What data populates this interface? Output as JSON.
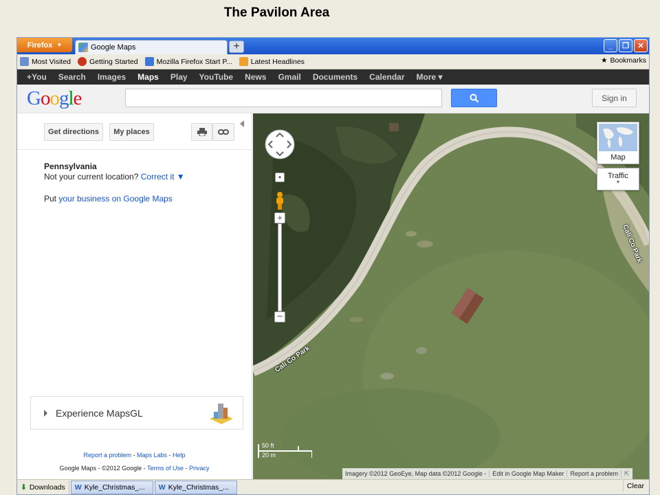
{
  "slide": {
    "title": "The Pavilon Area"
  },
  "browser": {
    "menu_button": "Firefox",
    "tab_title": "Google Maps",
    "new_tab": "+",
    "bookmarks": [
      "Most Visited",
      "Getting Started",
      "Mozilla Firefox Start P...",
      "Latest Headlines"
    ],
    "bookmarks_menu": "Bookmarks"
  },
  "google_bar": {
    "items": [
      "+You",
      "Search",
      "Images",
      "Maps",
      "Play",
      "YouTube",
      "News",
      "Gmail",
      "Documents",
      "Calendar",
      "More ▾"
    ],
    "active": "Maps"
  },
  "header": {
    "logo": [
      "G",
      "o",
      "o",
      "g",
      "l",
      "e"
    ],
    "search_value": "",
    "sign_in": "Sign in"
  },
  "left_panel": {
    "get_directions": "Get directions",
    "my_places": "My places",
    "location_title": "Pennsylvania",
    "location_prompt": "Not your current location?",
    "correct_it": "Correct it ▼",
    "put": "Put",
    "business_link": "your business on Google Maps",
    "mapsgl": "Experience MapsGL",
    "footer_links": [
      "Report a problem",
      "Maps Labs",
      "Help"
    ],
    "footer_copy": "Google Maps - ©2012 Google -",
    "terms": "Terms of Use",
    "privacy": "Privacy"
  },
  "map": {
    "map_type": "Map",
    "traffic": "Traffic",
    "road_label_1": "Cali Co Park",
    "road_label_2": "Cali Co Park",
    "scale_ft": "50 ft",
    "scale_m": "20 m",
    "imagery": "Imagery ©2012 GeoEye, Map data ©2012 Google -",
    "edit_link": "Edit in Google Map Maker",
    "report": "Report a problem"
  },
  "download_bar": {
    "downloads": "Downloads",
    "files": [
      "Kyle_Christmas_...",
      "Kyle_Christmas_..."
    ],
    "clear": "Clear"
  },
  "colors": {
    "google_blue": "#4d90fe",
    "link": "#1155cc",
    "firefox_orange": "#e06e12",
    "grass": "#6f8352",
    "forest": "#3b4a2e",
    "road": "#d9d5c8"
  }
}
